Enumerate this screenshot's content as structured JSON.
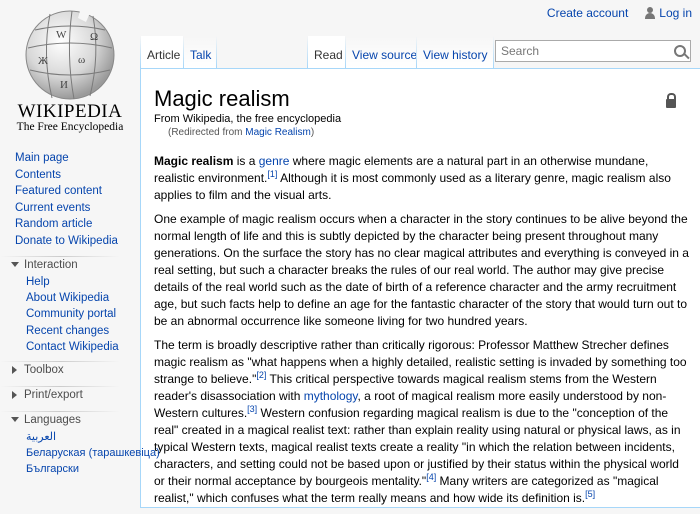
{
  "personal": {
    "create_account": "Create account",
    "log_in": "Log in"
  },
  "logo": {
    "wordmark": "WIKIPEDIA",
    "tagline": "The Free Encyclopedia"
  },
  "tabs": {
    "article": "Article",
    "talk": "Talk",
    "read": "Read",
    "view_source": "View source",
    "view_history": "View history"
  },
  "search": {
    "placeholder": "Search"
  },
  "article": {
    "title": "Magic realism",
    "site_sub": "From Wikipedia, the free encyclopedia",
    "redirect_prefix": "(Redirected from ",
    "redirect_link": "Magic Realism",
    "redirect_suffix": ")",
    "p1": {
      "bold": "Magic realism",
      "t1": " is a ",
      "link": "genre",
      "t2": " where magic elements are a natural part in an otherwise mundane, realistic environment.",
      "ref1": "[1]",
      "t3": " Although it is most commonly used as a literary genre, magic realism also applies to film and the visual arts."
    },
    "p2": "One example of magic realism occurs when a character in the story continues to be alive beyond the normal length of life and this is subtly depicted by the character being present throughout many generations. On the surface the story has no clear magical attributes and everything is conveyed in a real setting, but such a character breaks the rules of our real world. The author may give precise details of the real world such as the date of birth of a reference character and the army recruitment age, but such facts help to define an age for the fantastic character of the story that would turn out to be an abnormal occurrence like someone living for two hundred years.",
    "p3": {
      "t1": "The term is broadly descriptive rather than critically rigorous: Professor Matthew Strecher defines magic realism as \"what happens when a highly detailed, realistic setting is invaded by something too strange to believe.\"",
      "ref2": "[2]",
      "t2": " This critical perspective towards magical realism stems from the Western reader's disassociation with ",
      "link": "mythology",
      "t3": ", a root of magical realism more easily understood by non-Western cultures.",
      "ref3": "[3]",
      "t4": " Western confusion regarding magical realism is due to the \"conception of the real\" created in a magical realist text: rather than explain reality using natural or physical laws, as in typical Western texts, magical realist texts create a reality \"in which the relation between incidents, characters, and setting could not be based upon or justified by their status within the physical world or their normal acceptance by bourgeois mentality.\"",
      "ref4": "[4]",
      "t5": " Many writers are categorized as \"magical realist,\" which confuses what the term really means and how wide its definition is.",
      "ref5": "[5]"
    }
  },
  "sidebar": {
    "navigation": [
      "Main page",
      "Contents",
      "Featured content",
      "Current events",
      "Random article",
      "Donate to Wikipedia"
    ],
    "interaction": {
      "heading": "Interaction",
      "items": [
        "Help",
        "About Wikipedia",
        "Community portal",
        "Recent changes",
        "Contact Wikipedia"
      ]
    },
    "toolbox": "Toolbox",
    "print_export": "Print/export",
    "languages": {
      "heading": "Languages",
      "items": [
        "العربية",
        "Беларуская (тарашкевіца)",
        "Български"
      ]
    }
  }
}
